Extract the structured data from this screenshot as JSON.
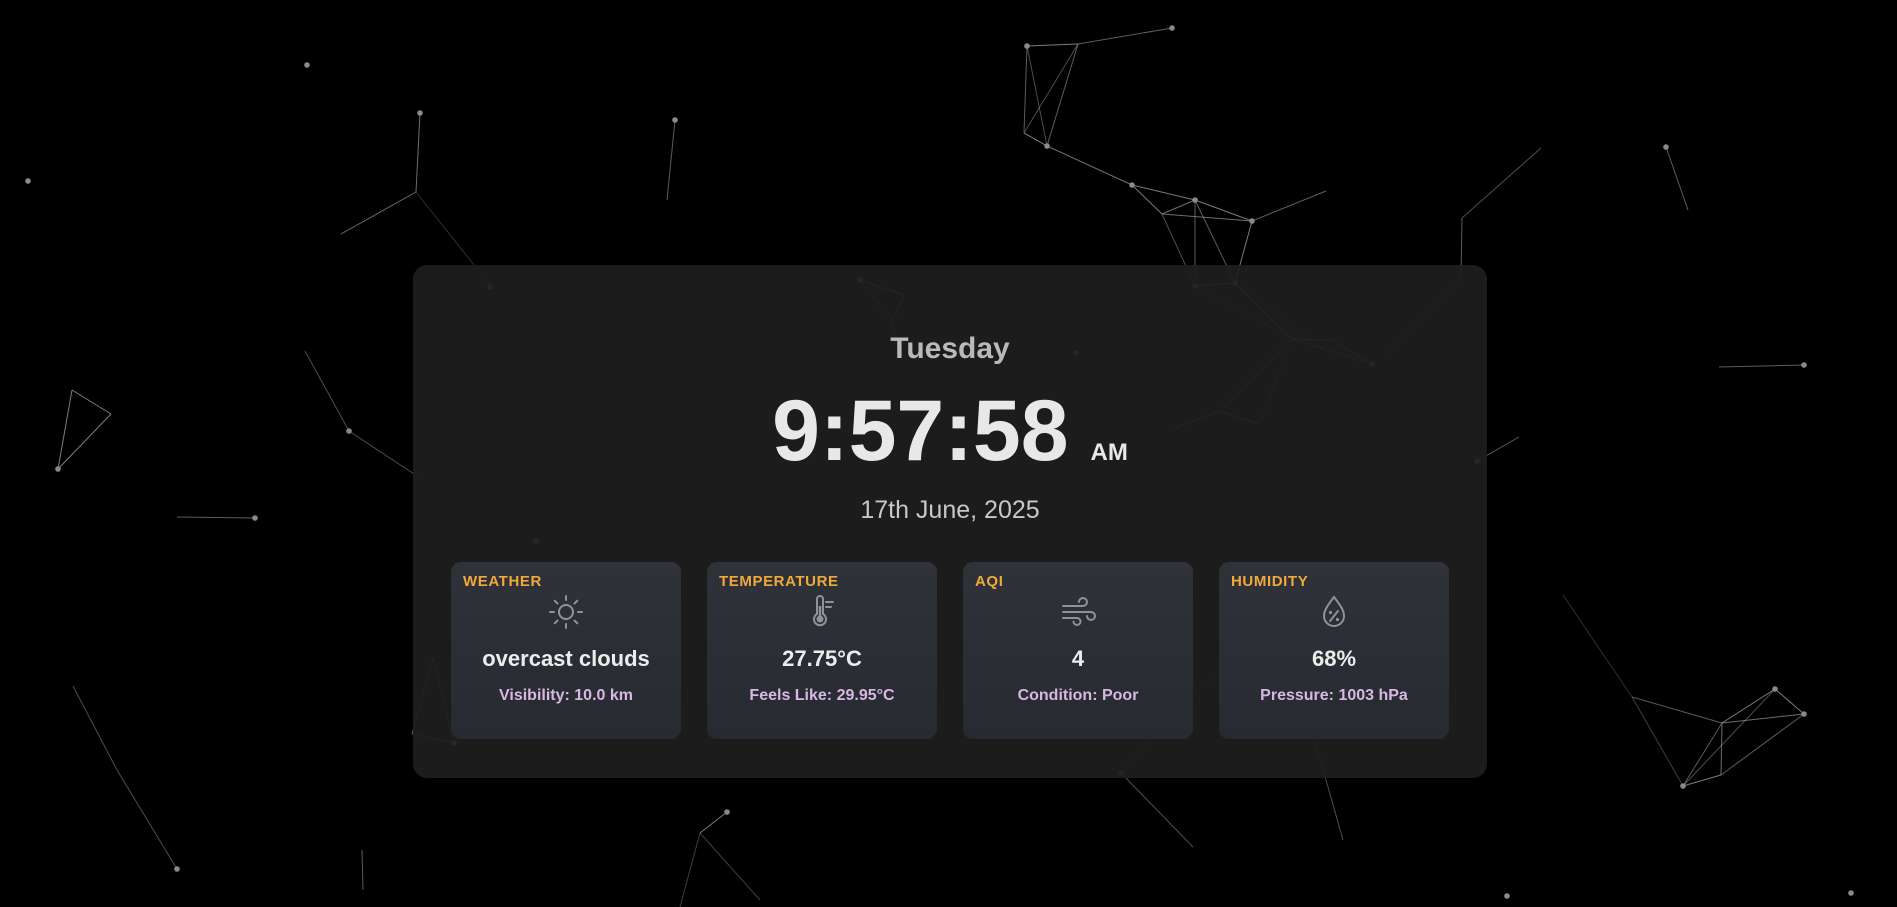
{
  "clock": {
    "day": "Tuesday",
    "time": "9:57:58",
    "meridiem": "AM",
    "date": "17th June, 2025"
  },
  "cards": [
    {
      "label": "WEATHER",
      "icon": "sun-icon",
      "value": "overcast clouds",
      "sub": "Visibility: 10.0 km"
    },
    {
      "label": "TEMPERATURE",
      "icon": "thermometer-icon",
      "value": "27.75°C",
      "sub": "Feels Like: 29.95°C"
    },
    {
      "label": "AQI",
      "icon": "wind-icon",
      "value": "4",
      "sub": "Condition: Poor"
    },
    {
      "label": "HUMIDITY",
      "icon": "humidity-drop-icon",
      "value": "68%",
      "sub": "Pressure: 1003 hPa"
    }
  ],
  "colors": {
    "background": "#000000",
    "panel": "#1e1e1e",
    "card": "#2c3036",
    "label_accent": "#f0a93a",
    "sub_text": "#d6b8e0",
    "network_line": "#9a9a9a"
  }
}
